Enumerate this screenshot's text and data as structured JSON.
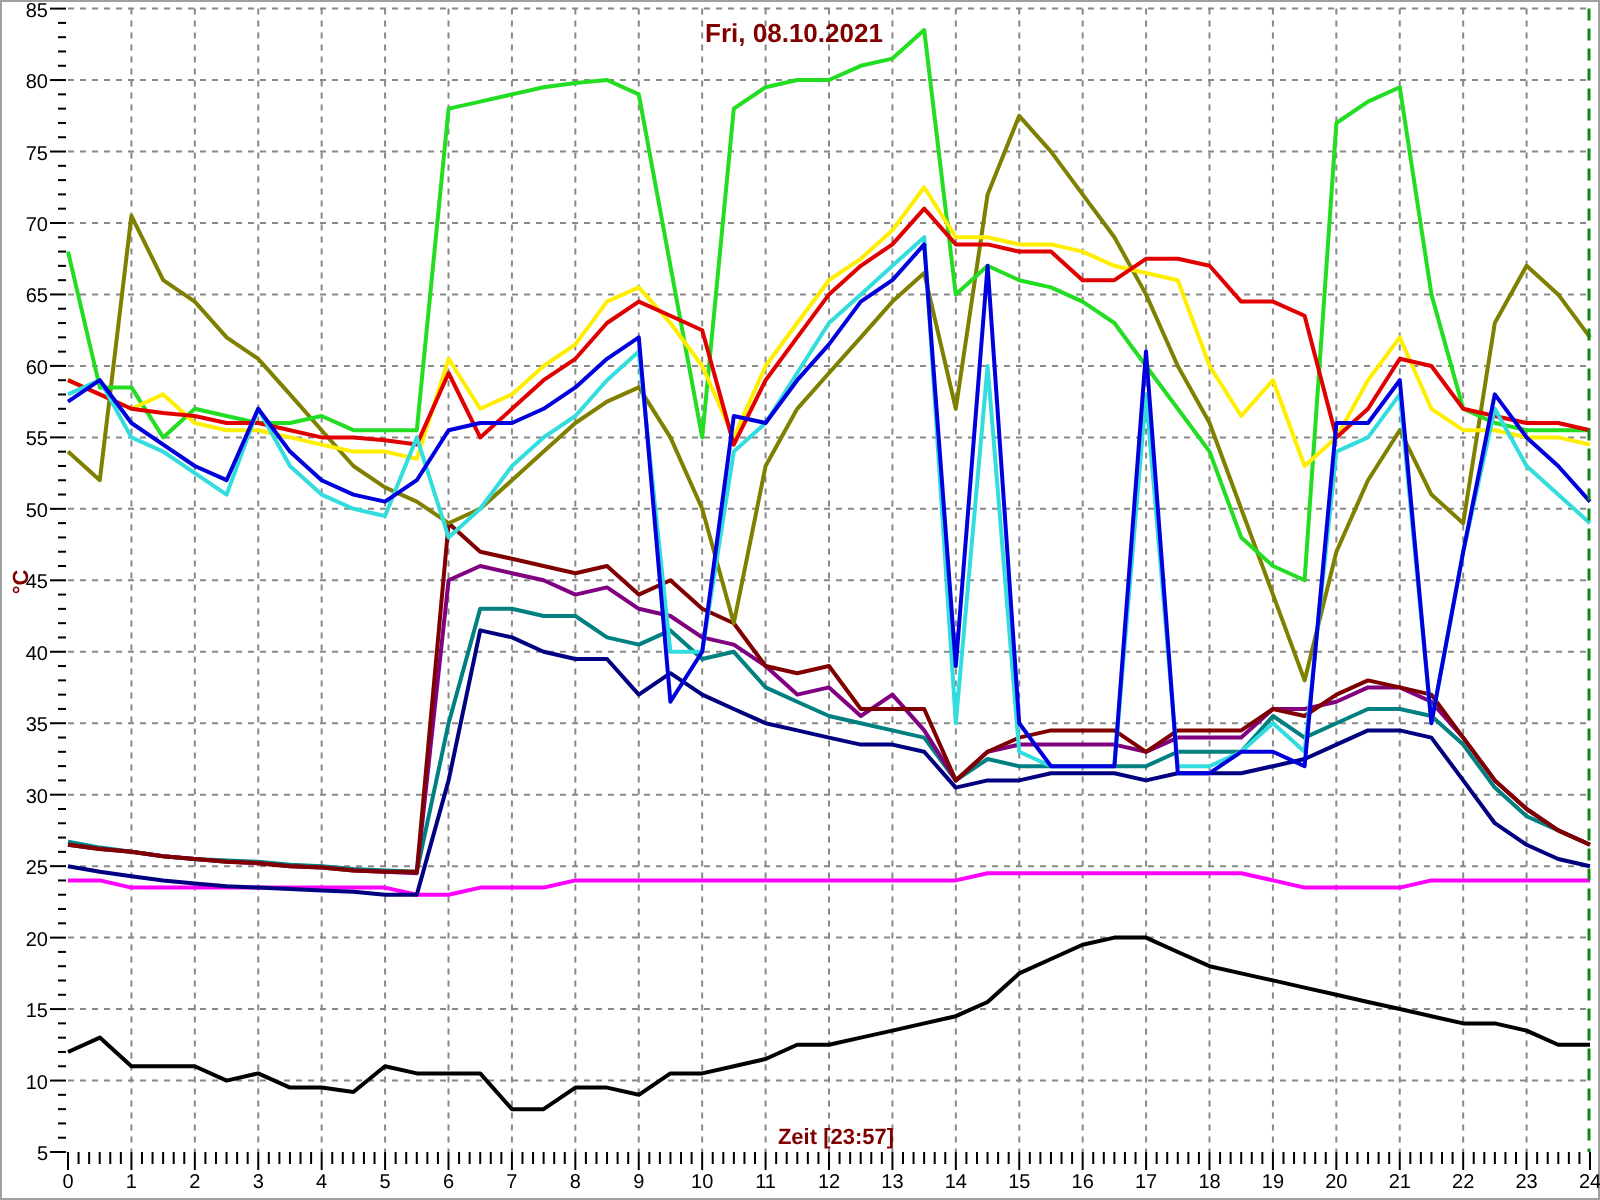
{
  "chart": {
    "chart_data": {
      "type": "line",
      "title": "Fri, 08.10.2021",
      "xlabel": "Zeit [23:57]",
      "ylabel": "°C",
      "x": [
        0,
        0.5,
        1,
        1.5,
        2,
        2.5,
        3,
        3.5,
        4,
        4.5,
        5,
        5.5,
        6,
        6.5,
        7,
        7.5,
        8,
        8.5,
        9,
        9.5,
        10,
        10.5,
        11,
        11.5,
        12,
        12.5,
        13,
        13.5,
        14,
        14.5,
        15,
        15.5,
        16,
        16.5,
        17,
        17.5,
        18,
        18.5,
        19,
        19.5,
        20,
        20.5,
        21,
        21.5,
        22,
        22.5,
        23,
        23.5,
        24
      ],
      "grid": true,
      "xlim": [
        0,
        24
      ],
      "ylim": [
        5,
        85
      ],
      "xticks": [
        0,
        1,
        2,
        3,
        4,
        5,
        6,
        7,
        8,
        9,
        10,
        11,
        12,
        13,
        14,
        15,
        16,
        17,
        18,
        19,
        20,
        21,
        22,
        23,
        24
      ],
      "yticks": [
        5,
        10,
        15,
        20,
        25,
        30,
        35,
        40,
        45,
        50,
        55,
        60,
        65,
        70,
        75,
        80,
        85
      ],
      "series": [
        {
          "color": "#000000",
          "values": [
            12,
            13,
            11,
            11,
            11,
            10,
            10.5,
            9.5,
            9.5,
            9.2,
            11,
            10.5,
            10.5,
            10.5,
            8,
            8,
            9.5,
            9.5,
            9,
            10.5,
            10.5,
            11,
            11.5,
            12.5,
            12.5,
            13,
            13.5,
            14,
            14.5,
            15.5,
            17.5,
            18.5,
            19.5,
            20,
            20,
            19,
            18,
            17.5,
            17,
            16.5,
            16,
            15.5,
            15,
            14.5,
            14,
            14,
            13.5,
            12.5,
            12.5
          ]
        },
        {
          "color": "#ff00ff",
          "values": [
            24,
            24,
            23.5,
            23.5,
            23.5,
            23.5,
            23.5,
            23.5,
            23.5,
            23.5,
            23.5,
            23,
            23,
            23.5,
            23.5,
            23.5,
            24,
            24,
            24,
            24,
            24,
            24,
            24,
            24,
            24,
            24,
            24,
            24,
            24,
            24.5,
            24.5,
            24.5,
            24.5,
            24.5,
            24.5,
            24.5,
            24.5,
            24.5,
            24,
            23.5,
            23.5,
            23.5,
            23.5,
            24,
            24,
            24,
            24,
            24,
            24
          ]
        },
        {
          "color": "#000080",
          "values": [
            25,
            24.6,
            24.3,
            24,
            23.8,
            23.6,
            23.5,
            23.4,
            23.3,
            23.2,
            23,
            23,
            31,
            41.5,
            41,
            40,
            39.5,
            39.5,
            37,
            38.5,
            37,
            36,
            35,
            34.5,
            34,
            33.5,
            33.5,
            33,
            30.5,
            31,
            31,
            31.5,
            31.5,
            31.5,
            31,
            31.5,
            31.5,
            31.5,
            32,
            32.5,
            33.5,
            34.5,
            34.5,
            34,
            31,
            28,
            26.5,
            25.5,
            25
          ]
        },
        {
          "color": "#008080",
          "values": [
            26.7,
            26.3,
            26,
            25.7,
            25.5,
            25.4,
            25.3,
            25.1,
            25,
            24.8,
            24.7,
            24.6,
            35,
            43,
            43,
            42.5,
            42.5,
            41,
            40.5,
            41.5,
            39.5,
            40,
            37.5,
            36.5,
            35.5,
            35,
            34.5,
            34,
            31,
            32.5,
            32,
            32,
            32,
            32,
            32,
            33,
            33,
            33,
            35.5,
            34,
            35,
            36,
            36,
            35.5,
            33.5,
            30.5,
            28.5,
            27.5,
            26.5
          ]
        },
        {
          "color": "#800080",
          "values": [
            26.5,
            26.2,
            26,
            25.7,
            25.5,
            25.3,
            25.2,
            25,
            24.9,
            24.7,
            24.6,
            24.5,
            45,
            46,
            45.5,
            45,
            44,
            44.5,
            43,
            42.5,
            41,
            40.5,
            39,
            37,
            37.5,
            35.5,
            37,
            34.5,
            31,
            33,
            33.5,
            33.5,
            33.5,
            33.5,
            33,
            34,
            34,
            34,
            36,
            36,
            36.5,
            37.5,
            37.5,
            36.5,
            34,
            31,
            29,
            27.5,
            26.5
          ]
        },
        {
          "color": "#800000",
          "values": [
            26.5,
            26.2,
            26,
            25.7,
            25.5,
            25.3,
            25.2,
            25,
            24.9,
            24.7,
            24.6,
            24.6,
            49,
            47,
            46.5,
            46,
            45.5,
            46,
            44,
            45,
            43,
            42,
            39,
            38.5,
            39,
            36,
            36,
            36,
            31,
            33,
            34,
            34.5,
            34.5,
            34.5,
            33,
            34.5,
            34.5,
            34.5,
            36,
            35.5,
            37,
            38,
            37.5,
            37,
            34,
            31,
            29,
            27.5,
            26.5
          ]
        },
        {
          "color": "#808000",
          "values": [
            54,
            52,
            70.5,
            66,
            64.5,
            62,
            60.5,
            58,
            55.5,
            53,
            51.5,
            50.5,
            49,
            50,
            52,
            54,
            56,
            57.5,
            58.5,
            55,
            50,
            42,
            53,
            57,
            59.5,
            62,
            64.5,
            66.5,
            57,
            72,
            77.5,
            75,
            72,
            69,
            65,
            60,
            56,
            50,
            44,
            38,
            47,
            52,
            55.5,
            51,
            49,
            63,
            67,
            65,
            62
          ]
        },
        {
          "color": "#22dd22",
          "values": [
            68,
            58.5,
            58.5,
            55,
            57,
            56.5,
            56,
            56,
            56.5,
            55.5,
            55.5,
            55.5,
            78,
            78.5,
            79,
            79.5,
            79.8,
            80,
            79,
            67,
            55,
            78,
            79.5,
            80,
            80,
            81,
            81.5,
            83.5,
            65,
            67,
            66,
            65.5,
            64.5,
            63,
            60,
            57,
            54,
            48,
            46,
            45,
            77,
            78.5,
            79.5,
            65,
            57,
            56,
            55.5,
            55.5,
            55.5
          ]
        },
        {
          "color": "#ffee00",
          "values": [
            59,
            58,
            57,
            58,
            56,
            55.5,
            55.5,
            55,
            54.5,
            54,
            54,
            53.5,
            60.5,
            57,
            58,
            60,
            61.5,
            64.5,
            65.5,
            63,
            60,
            55,
            60,
            63,
            66,
            67.5,
            69.5,
            72.5,
            69,
            69,
            68.5,
            68.5,
            68,
            67,
            66.5,
            66,
            60,
            56.5,
            59,
            53,
            55,
            59,
            62,
            57,
            55.5,
            55.5,
            55,
            55,
            54.5
          ]
        },
        {
          "color": "#e00000",
          "values": [
            59,
            58,
            57,
            56.7,
            56.5,
            56,
            56,
            55.5,
            55,
            55,
            54.8,
            54.5,
            59.5,
            55,
            57,
            59,
            60.5,
            63,
            64.5,
            63.5,
            62.5,
            54.5,
            59,
            62,
            65,
            67,
            68.5,
            71,
            68.5,
            68.5,
            68,
            68,
            66,
            66,
            67.5,
            67.5,
            67,
            64.5,
            64.5,
            63.5,
            55,
            57,
            60.5,
            60,
            57,
            56.5,
            56,
            56,
            55.5
          ]
        },
        {
          "color": "#33dddd",
          "values": [
            58,
            59,
            55,
            54,
            52.5,
            51,
            57,
            53,
            51,
            50,
            49.5,
            55,
            48,
            50,
            53,
            55,
            56.5,
            59,
            61,
            40,
            40,
            54,
            56,
            59.5,
            63,
            65,
            67,
            69,
            35,
            60,
            33,
            32,
            32,
            32,
            58,
            32,
            32,
            33,
            35,
            33,
            54,
            55,
            58,
            35,
            47,
            57,
            53,
            51,
            49
          ]
        },
        {
          "color": "#0000dd",
          "values": [
            57.5,
            59,
            56,
            54.5,
            53,
            52,
            57,
            54,
            52,
            51,
            50.5,
            52,
            55.5,
            56,
            56,
            57,
            58.5,
            60.5,
            62,
            36.5,
            40,
            56.5,
            56,
            59,
            61.5,
            64.5,
            66,
            68.5,
            39,
            67,
            35,
            32,
            32,
            32,
            61,
            31.5,
            31.5,
            33,
            33,
            32,
            56,
            56,
            59,
            35,
            47,
            58,
            55,
            53,
            50.5
          ]
        }
      ]
    }
  }
}
